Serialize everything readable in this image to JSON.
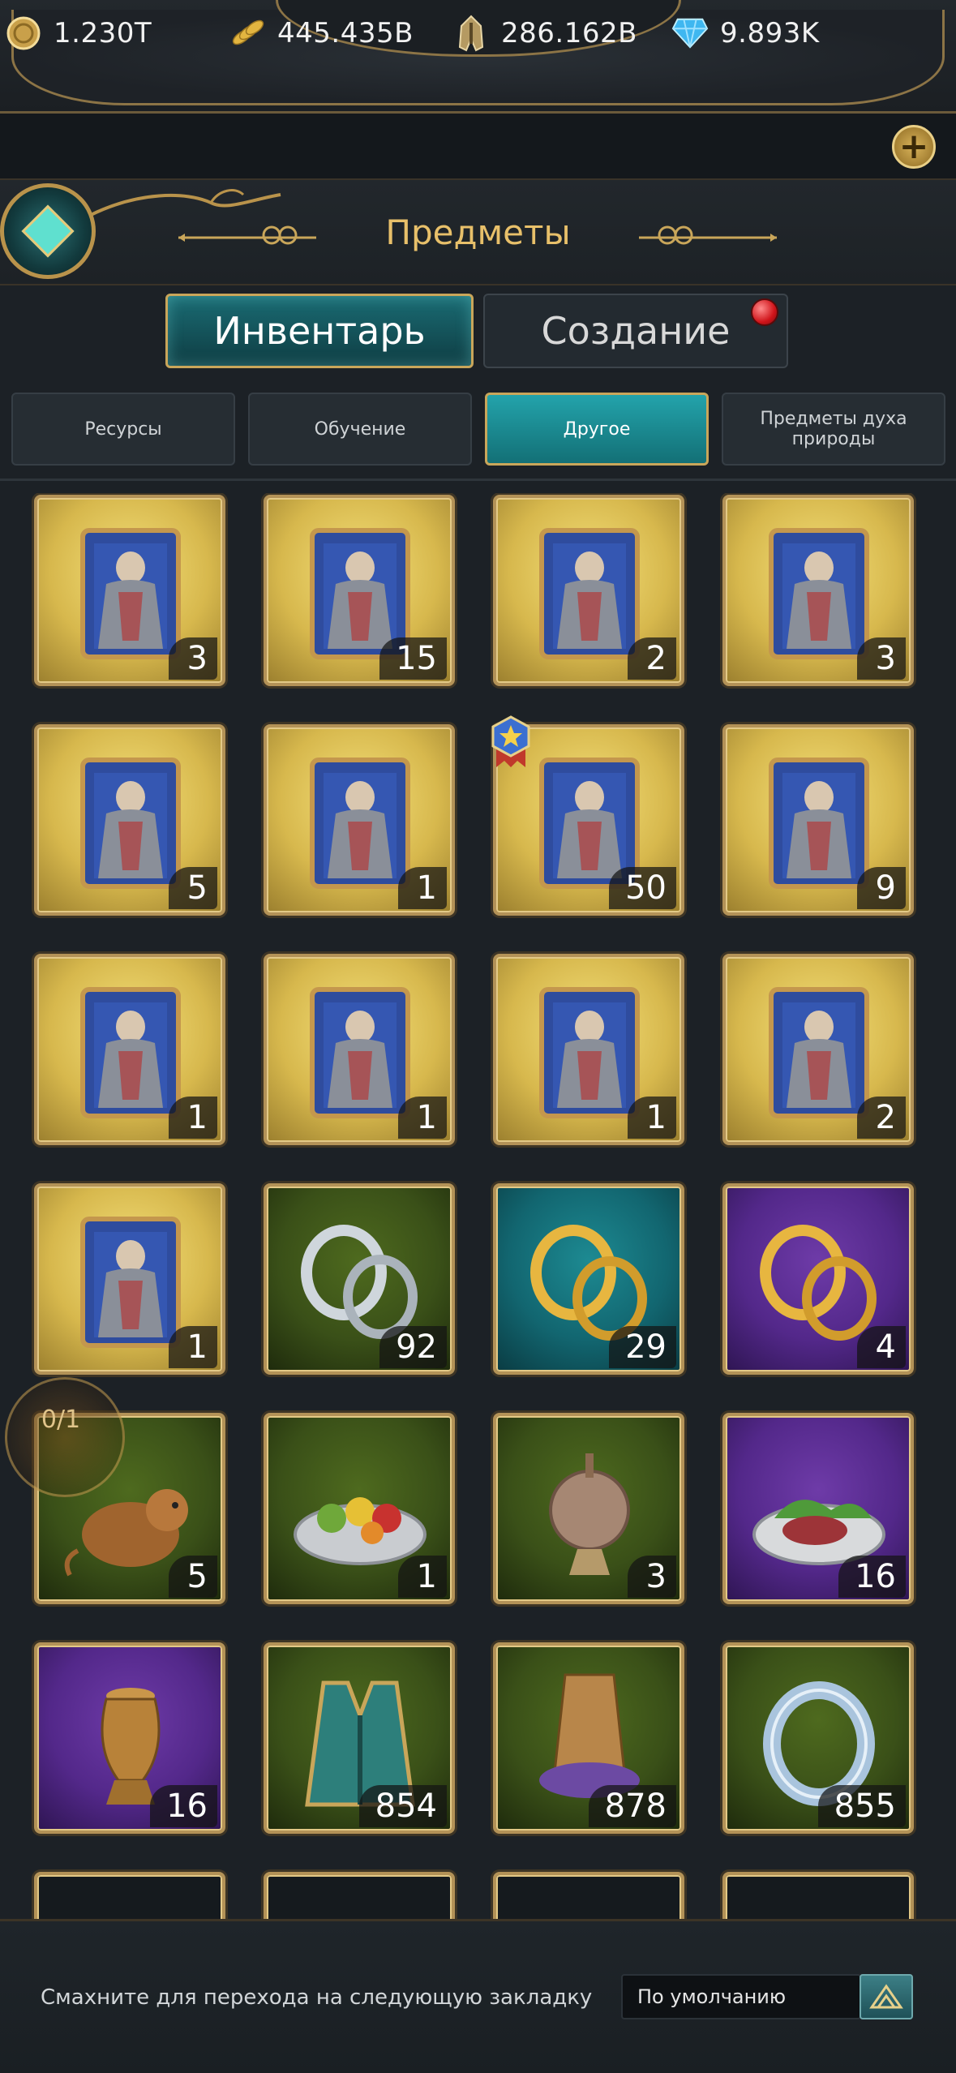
{
  "resources": [
    {
      "icon": "coin-icon",
      "value": "1.230T"
    },
    {
      "icon": "wheat-icon",
      "value": "445.435B"
    },
    {
      "icon": "helmet-icon",
      "value": "286.162B"
    },
    {
      "icon": "diamond-icon",
      "value": "9.893K"
    }
  ],
  "header": {
    "title": "Предметы"
  },
  "tabs": {
    "inventory": "Инвентарь",
    "crafting": "Создание"
  },
  "subtabs": [
    "Ресурсы",
    "Обучение",
    "Другое",
    "Предметы духа природы"
  ],
  "active_subtab": 2,
  "items": [
    {
      "type": "costume-card",
      "bg": "gold",
      "count": "3"
    },
    {
      "type": "costume-card",
      "bg": "gold",
      "count": "15"
    },
    {
      "type": "costume-card",
      "bg": "gold",
      "count": "2"
    },
    {
      "type": "costume-card",
      "bg": "gold",
      "count": "3"
    },
    {
      "type": "costume-card",
      "bg": "gold",
      "count": "5"
    },
    {
      "type": "costume-card",
      "bg": "gold",
      "count": "1"
    },
    {
      "type": "costume-card",
      "bg": "gold",
      "count": "50"
    },
    {
      "type": "costume-card",
      "bg": "gold",
      "count": "9"
    },
    {
      "type": "costume-card",
      "bg": "gold",
      "count": "1"
    },
    {
      "type": "costume-card",
      "bg": "gold",
      "count": "1"
    },
    {
      "type": "costume-card",
      "bg": "gold",
      "count": "1"
    },
    {
      "type": "costume-card",
      "bg": "gold",
      "count": "2"
    },
    {
      "type": "costume-card",
      "bg": "gold",
      "count": "1"
    },
    {
      "type": "silver-rings",
      "bg": "green",
      "count": "92"
    },
    {
      "type": "gold-rings",
      "bg": "teal",
      "count": "29"
    },
    {
      "type": "gold-rings",
      "bg": "purple",
      "count": "4"
    },
    {
      "type": "hamster",
      "bg": "green",
      "count": "5"
    },
    {
      "type": "fruit-plate",
      "bg": "green",
      "count": "1"
    },
    {
      "type": "incense-burner",
      "bg": "green",
      "count": "3"
    },
    {
      "type": "meat-plate",
      "bg": "purple",
      "count": "16"
    },
    {
      "type": "golden-urn",
      "bg": "purple",
      "count": "16"
    },
    {
      "type": "vest",
      "bg": "green",
      "count": "854"
    },
    {
      "type": "fez-hat",
      "bg": "green",
      "count": "878"
    },
    {
      "type": "silver-ring",
      "bg": "green",
      "count": "855"
    }
  ],
  "floating_counter": "0/1",
  "footer": {
    "hint": "Смахните для перехода на следующую закладку",
    "sort_value": "По умолчанию"
  }
}
